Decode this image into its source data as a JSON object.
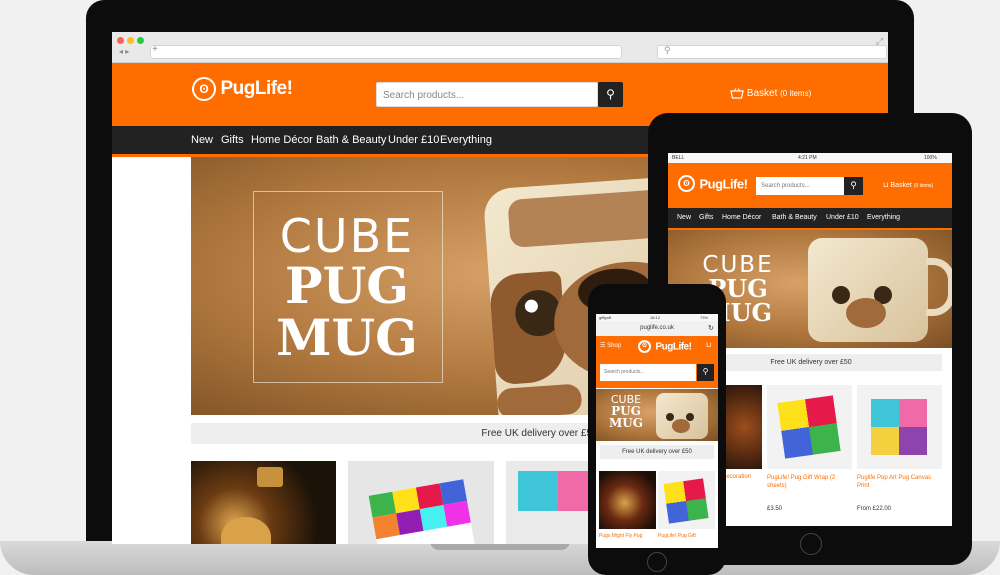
{
  "brand": {
    "name": "PugLife!",
    "accent": "#ff6d00",
    "dark": "#222222"
  },
  "desktop": {
    "search_placeholder": "Search products...",
    "basket_label": "Basket",
    "basket_count": "(0 items)",
    "nav": [
      "New",
      "Gifts",
      "Home Décor",
      "Bath & Beauty",
      "Under £10",
      "Everything"
    ],
    "hero": {
      "line1": "CUBE",
      "line2": "PUG",
      "line3": "MUG"
    },
    "delivery": "Free UK delivery over £50"
  },
  "tablet": {
    "status_carrier": "BELL",
    "status_time": "4:21 PM",
    "status_battery": "100%",
    "search_placeholder": "Search products...",
    "basket_label": "Basket",
    "basket_count": "(0 items)",
    "nav": [
      "New",
      "Gifts",
      "Home Décor",
      "Bath & Beauty",
      "Under £10",
      "Everything"
    ],
    "hero": {
      "line1": "CUBE",
      "line2": "PUG",
      "line3": "MUG"
    },
    "delivery": "Free UK delivery over £50",
    "products": [
      {
        "name": "g\ndecoration",
        "price": ""
      },
      {
        "name": "PugLife! Pug Gift Wrap (2 sheets)",
        "price": "£3.50"
      },
      {
        "name": "Puglife Pop Art Pug Canvas Print",
        "price": "From £22.00"
      }
    ]
  },
  "phone": {
    "status_carrier": "giffgaff",
    "status_time": "18:12",
    "status_battery": "73%",
    "url": "puglife.co.uk",
    "shop_label": "Shop",
    "search_placeholder": "Search products...",
    "hero": {
      "line1": "CUBE",
      "line2": "PUG",
      "line3": "MUG"
    },
    "delivery": "Free UK delivery over £50",
    "products": [
      {
        "name": "Pugs Might Fly Pug"
      },
      {
        "name": "PugLife! Pug Gift"
      }
    ]
  },
  "icons": [
    "search-icon",
    "basket-icon",
    "menu-icon",
    "reload-icon",
    "pug-logo-icon"
  ]
}
